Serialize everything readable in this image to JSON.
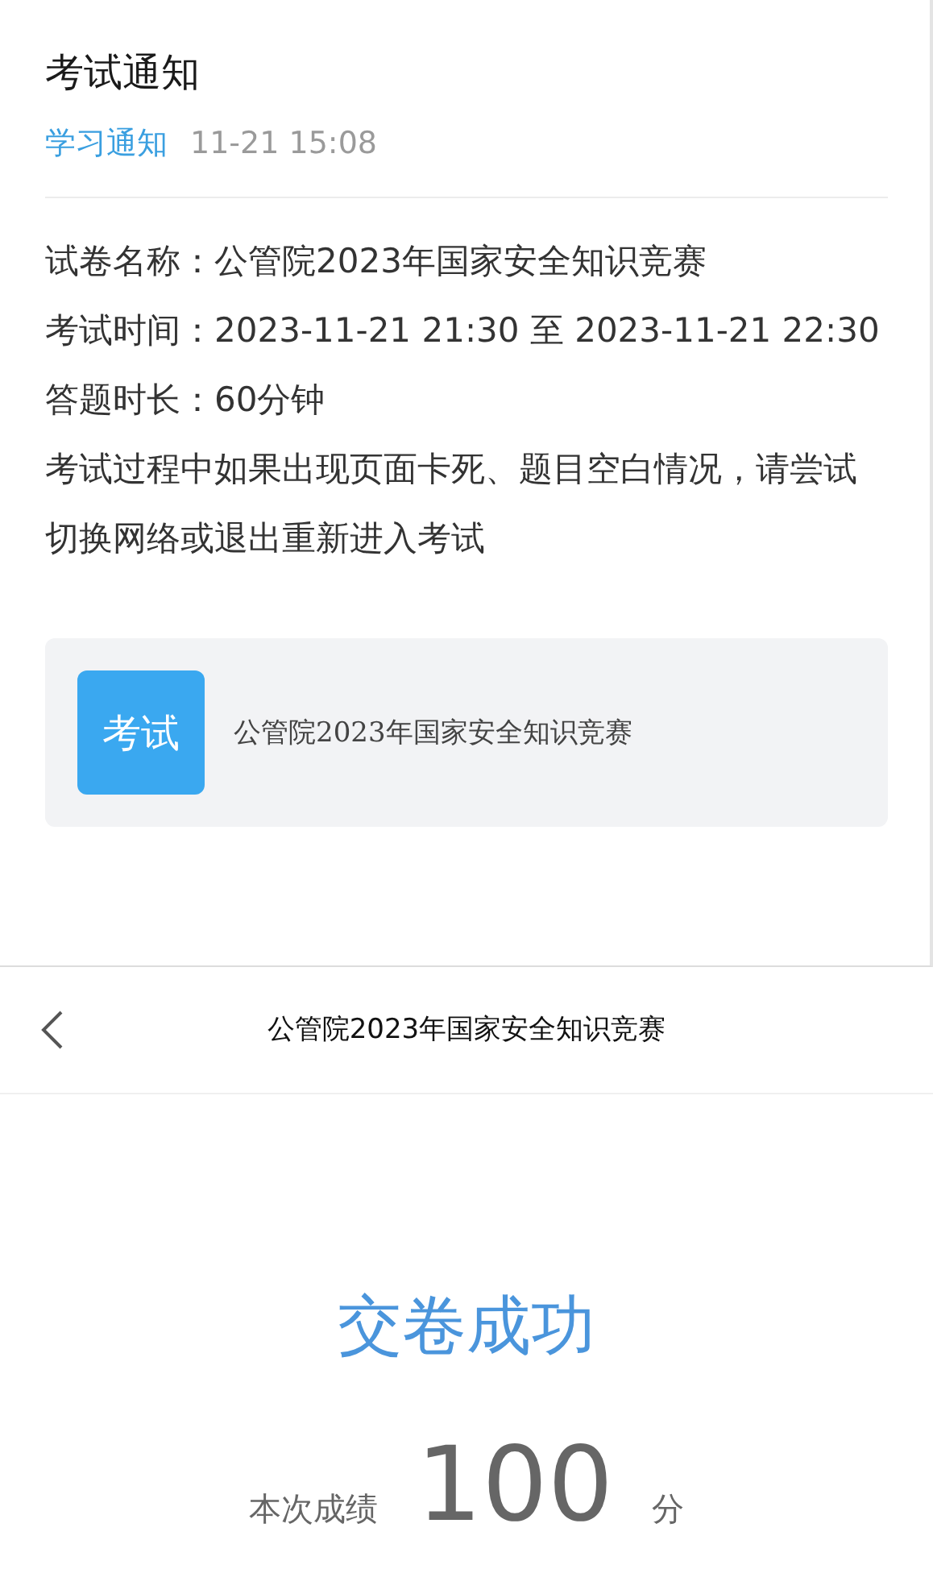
{
  "notice": {
    "title": "考试通知",
    "category": "学习通知",
    "time": "11-21 15:08",
    "lines": [
      "试卷名称：公管院2023年国家安全知识竞赛",
      "考试时间：2023-11-21 21:30 至 2023-11-21 22:30",
      "答题时长：60分钟",
      "考试过程中如果出现页面卡死、题目空白情况，请尝试切换网络或退出重新进入考试"
    ],
    "attachment": {
      "badge": "考试",
      "title": "公管院2023年国家安全知识竞赛"
    }
  },
  "result_page": {
    "title": "公管院2023年国家安全知识竞赛",
    "status": "交卷成功",
    "score_label": "本次成绩",
    "score": "100",
    "unit": "分"
  }
}
